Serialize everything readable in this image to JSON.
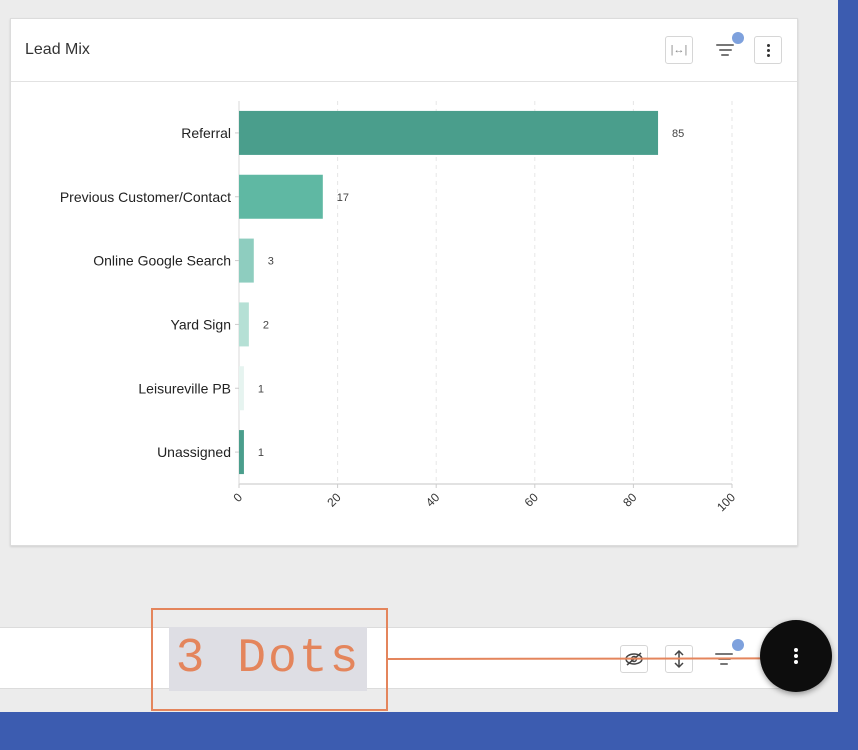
{
  "card": {
    "title": "Lead Mix",
    "buttons": {
      "expand_icon": "|↔|",
      "filter_icon": "filter-icon",
      "more_icon": "vertical-dots-icon"
    }
  },
  "chart_data": {
    "type": "bar",
    "orientation": "horizontal",
    "title": "",
    "xlabel": "",
    "ylabel": "",
    "xlim": [
      0,
      100
    ],
    "ticks": [
      "0",
      "20",
      "40",
      "60",
      "80",
      "100"
    ],
    "tick_values": [
      0,
      20,
      40,
      60,
      80,
      100
    ],
    "categories": [
      "Referral",
      "Previous Customer/Contact",
      "Online Google Search",
      "Yard Sign",
      "Leisureville PB",
      "Unassigned"
    ],
    "values": [
      85,
      17,
      3,
      2,
      1,
      1
    ],
    "colors": [
      "#4a9e8c",
      "#5fb8a3",
      "#8ecdbf",
      "#b5e0d5",
      "#e6f4f0",
      "#4a9e8c"
    ],
    "grid": true,
    "legend": "none"
  },
  "panel2": {
    "buttons": {
      "hide_icon": "eye-off-icon",
      "sort_icon": "sort-arrows-icon",
      "filter_icon": "filter-icon"
    }
  },
  "annotation": {
    "label": "3 Dots",
    "color": "#e4855c"
  },
  "fab": {
    "icon": "vertical-dots-icon"
  }
}
